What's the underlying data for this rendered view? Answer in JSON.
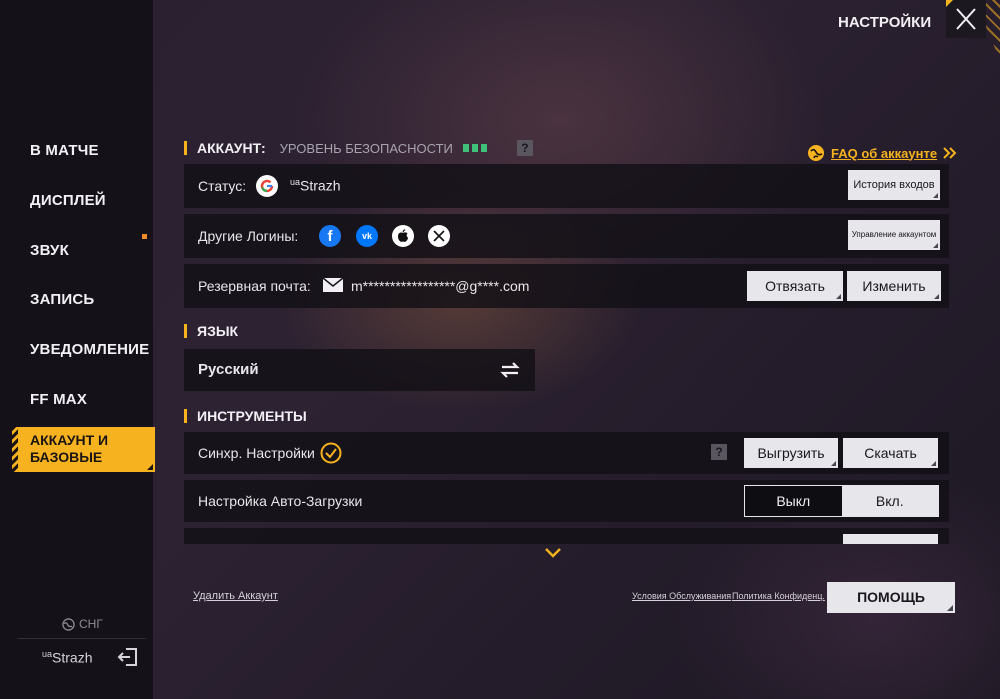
{
  "header": {
    "title": "НАСТРОЙКИ",
    "close_icon": "close-icon"
  },
  "sidebar": {
    "items": [
      {
        "label": "В МАТЧЕ"
      },
      {
        "label": "ДИСПЛЕЙ"
      },
      {
        "label": "ЗВУК"
      },
      {
        "label": "ЗАПИСЬ"
      },
      {
        "label": "УВЕДОМЛЕНИЕ"
      },
      {
        "label": "FF MAX"
      },
      {
        "label": "АККАУНТ И БАЗОВЫЕ",
        "active": true
      }
    ],
    "region": "СНГ",
    "user_prefix": "ua",
    "user_name": "Strazh"
  },
  "account": {
    "heading": "АККАУНТ:",
    "security_label": "УРОВЕНЬ БЕЗОПАСНОСТИ",
    "security_level": 3,
    "faq_link": "FAQ об аккаунте",
    "status_label": "Статус:",
    "status_user_prefix": "ua",
    "status_user_name": "Strazh",
    "history_button": "История входов",
    "other_logins_label": "Другие Логины:",
    "manage_button": "Управление аккаунтом",
    "backup_email_label": "Резервная почта:",
    "backup_email_value": "m*****************@g****.com",
    "unlink_button": "Отвязать",
    "change_button": "Изменить"
  },
  "language": {
    "heading": "ЯЗЫК",
    "value": "Русский"
  },
  "tools": {
    "heading": "ИНСТРУМЕНТЫ",
    "sync_label": "Синхр. Настройки",
    "upload_button": "Выгрузить",
    "download_button": "Скачать",
    "autoload_label": "Настройка Авто-Загрузки",
    "toggle_off": "Выкл",
    "toggle_on": "Вкл.",
    "toggle_selected": "Вкл."
  },
  "footer": {
    "delete_account": "Удалить Аккаунт",
    "terms": "Условия Обслуживания",
    "privacy": "Политика Конфиденц.",
    "help_button": "ПОМОЩЬ"
  },
  "colors": {
    "accent": "#f7b21f",
    "security_green": "#3ec27a",
    "facebook": "#1877f2",
    "vk": "#0077ff"
  }
}
